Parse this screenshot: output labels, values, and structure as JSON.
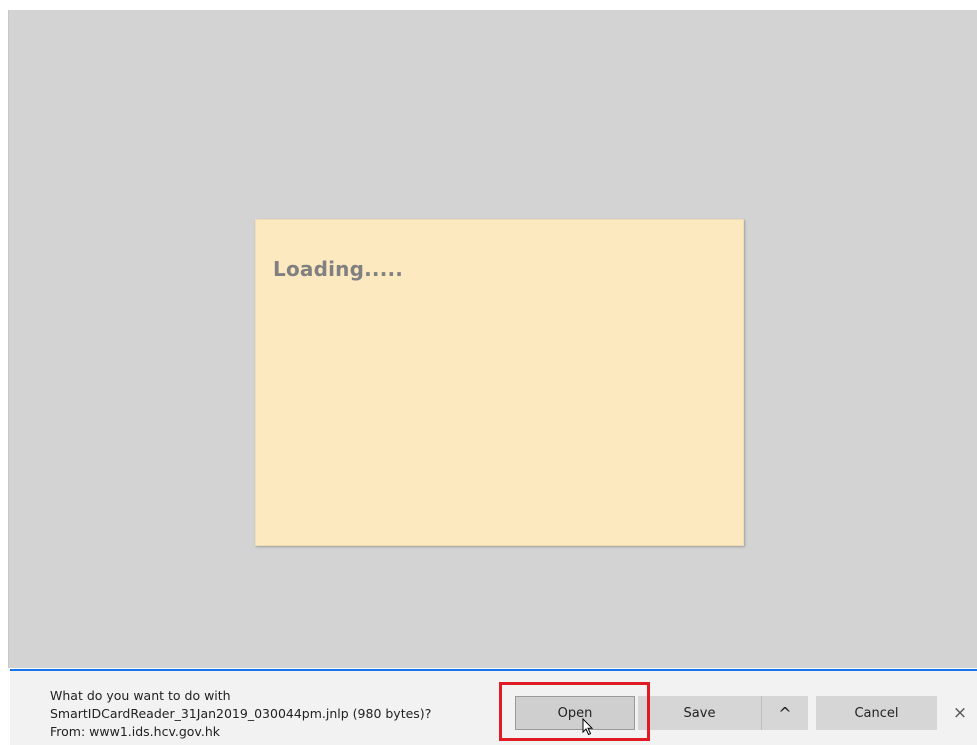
{
  "page": {
    "loading_text": "Loading....."
  },
  "download_bar": {
    "line1": "What do you want to do with",
    "line2": "SmartIDCardReader_31Jan2019_030044pm.jnlp (980 bytes)?",
    "line3": "From: www1.ids.hcv.gov.hk",
    "open_label": "Open",
    "save_label": "Save",
    "more_icon": "^",
    "cancel_label": "Cancel",
    "close_icon": "×"
  },
  "colors": {
    "viewport_bg": "#d3d3d3",
    "card_bg": "#fde9c0",
    "bar_accent": "#1a73e8",
    "highlight": "#e01b24"
  },
  "icons": {
    "more": "chevron-up-icon",
    "close": "close-icon",
    "cursor": "mouse-cursor-icon"
  }
}
